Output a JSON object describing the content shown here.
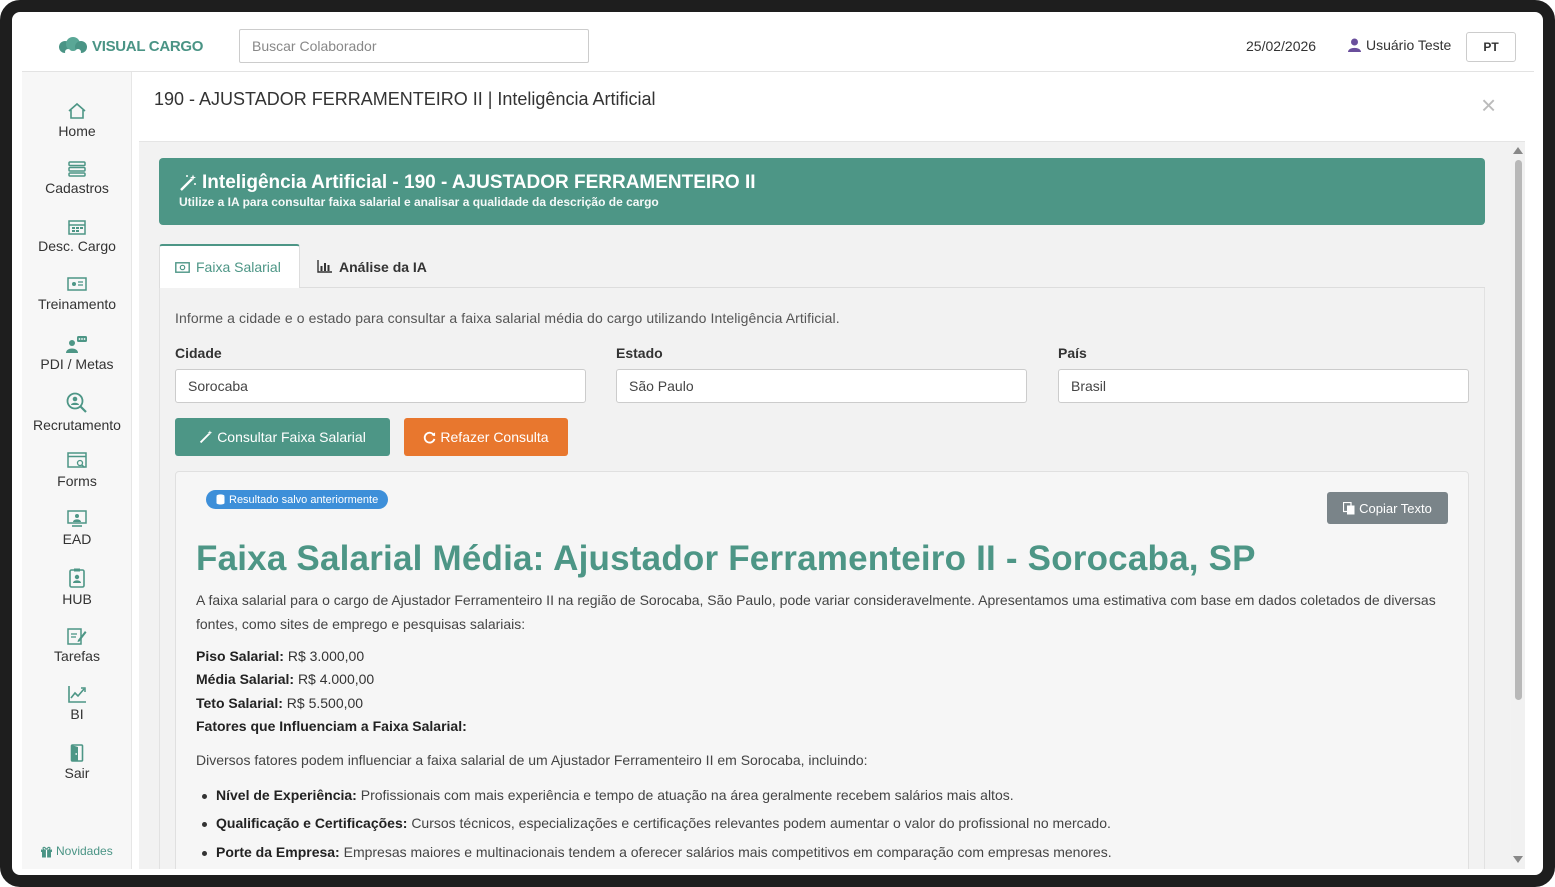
{
  "header": {
    "logo_text": "VISUAL CARGO",
    "search_placeholder": "Buscar Colaborador",
    "date": "25/02/2026",
    "user_name": "Usuário Teste",
    "language": "PT"
  },
  "sidebar": {
    "items": [
      {
        "label": "Home",
        "icon": "home-icon"
      },
      {
        "label": "Cadastros",
        "icon": "list-icon"
      },
      {
        "label": "Desc. Cargo",
        "icon": "calendar-icon"
      },
      {
        "label": "Treinamento",
        "icon": "presentation-icon"
      },
      {
        "label": "PDI / Metas",
        "icon": "user-chat-icon"
      },
      {
        "label": "Recrutamento",
        "icon": "search-user-icon"
      },
      {
        "label": "Forms",
        "icon": "form-icon"
      },
      {
        "label": "EAD",
        "icon": "monitor-user-icon"
      },
      {
        "label": "HUB",
        "icon": "clipboard-user-icon"
      },
      {
        "label": "Tarefas",
        "icon": "edit-icon"
      },
      {
        "label": "BI",
        "icon": "chart-icon"
      },
      {
        "label": "Sair",
        "icon": "exit-door-icon"
      }
    ],
    "footer_label": "Novidades"
  },
  "panel": {
    "title": "190 - AJUSTADOR FERRAMENTEIRO II | Inteligência Artificial",
    "close_symbol": "×"
  },
  "banner": {
    "title": "Inteligência Artificial - 190 - AJUSTADOR FERRAMENTEIRO II",
    "subtitle": "Utilize a IA para consultar faixa salarial e analisar a qualidade da descrição de cargo"
  },
  "tabs": {
    "salary": "Faixa Salarial",
    "analysis": "Análise da IA"
  },
  "form": {
    "intro": "Informe a cidade e o estado para consultar a faixa salarial média do cargo utilizando Inteligência Artificial.",
    "city_label": "Cidade",
    "city_value": "Sorocaba",
    "state_label": "Estado",
    "state_value": "São Paulo",
    "country_label": "País",
    "country_value": "Brasil",
    "consult_button": "Consultar Faixa Salarial",
    "redo_button": "Refazer Consulta"
  },
  "result": {
    "saved_badge": "Resultado salvo anteriormente",
    "copy_button": "Copiar Texto",
    "title": "Faixa Salarial Média: Ajustador Ferramenteiro II - Sorocaba, SP",
    "paragraph": "A faixa salarial para o cargo de Ajustador Ferramenteiro II na região de Sorocaba, São Paulo, pode variar consideravelmente. Apresentamos uma estimativa com base em dados coletados de diversas fontes, como sites de emprego e pesquisas salariais:",
    "floor_label": "Piso Salarial:",
    "floor_value": "R$ 3.000,00",
    "avg_label": "Média Salarial:",
    "avg_value": "R$ 4.000,00",
    "ceiling_label": "Teto Salarial:",
    "ceiling_value": "R$ 5.500,00",
    "factors_title": "Fatores que Influenciam a Faixa Salarial:",
    "factors_intro": "Diversos fatores podem influenciar a faixa salarial de um Ajustador Ferramenteiro II em Sorocaba, incluindo:",
    "factors": [
      {
        "label": "Nível de Experiência:",
        "text": "Profissionais com mais experiência e tempo de atuação na área geralmente recebem salários mais altos."
      },
      {
        "label": "Qualificação e Certificações:",
        "text": "Cursos técnicos, especializações e certificações relevantes podem aumentar o valor do profissional no mercado."
      },
      {
        "label": "Porte da Empresa:",
        "text": "Empresas maiores e multinacionais tendem a oferecer salários mais competitivos em comparação com empresas menores."
      }
    ]
  },
  "colors": {
    "primary": "#4d9686",
    "orange": "#e8772e",
    "badge_blue": "#3d8fd9",
    "copy_gray": "#7a8489"
  }
}
